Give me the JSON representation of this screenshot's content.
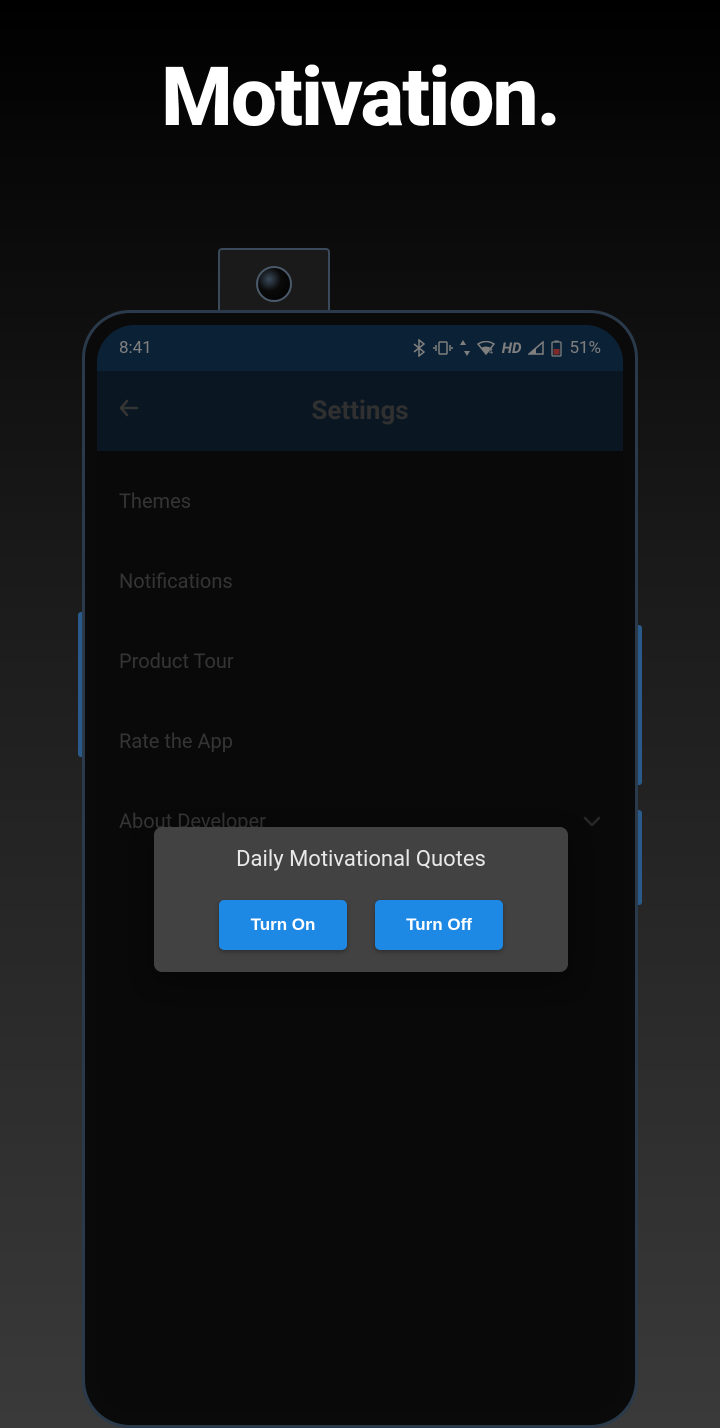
{
  "promo": {
    "title": "Motivation."
  },
  "statusBar": {
    "time": "8:41",
    "hd": "HD",
    "battery": "51%"
  },
  "appBar": {
    "title": "Settings"
  },
  "settings": {
    "items": [
      {
        "label": "Themes"
      },
      {
        "label": "Notifications"
      },
      {
        "label": "Product Tour"
      },
      {
        "label": "Rate the App"
      },
      {
        "label": "About Developer"
      }
    ]
  },
  "dialog": {
    "title": "Daily Motivational Quotes",
    "turnOn": "Turn On",
    "turnOff": "Turn Off"
  }
}
